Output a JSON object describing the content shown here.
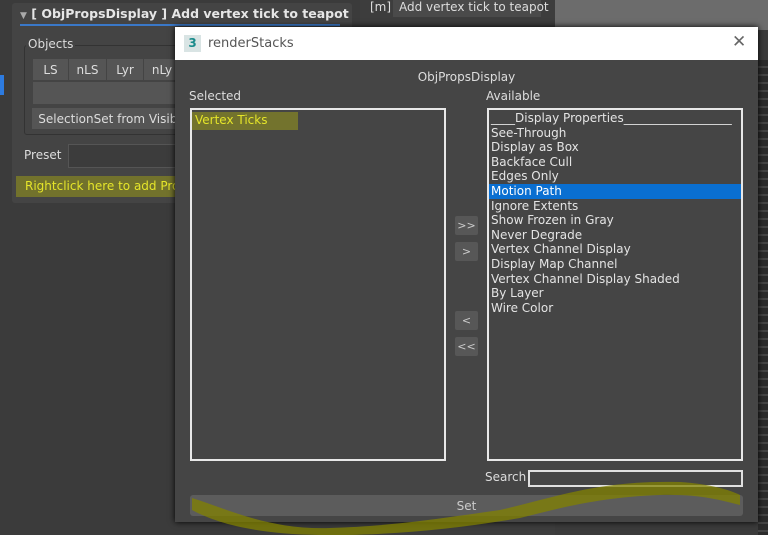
{
  "rollout": {
    "title": "[ ObjPropsDisplay ] Add vertex tick to teapot",
    "objects_label": "Objects",
    "buttons": [
      "LS",
      "nLS",
      "Lyr",
      "nLy"
    ],
    "selection_set": "SelectionSet from Visibl",
    "preset_label": "Preset",
    "hint": "Rightclick here to add Prope"
  },
  "side": {
    "m_label": "[m]",
    "macro": "Add vertex tick to teapot"
  },
  "dialog": {
    "title": "renderStacks",
    "icon_text": "3",
    "heading": "ObjPropsDisplay",
    "selected_label": "Selected",
    "available_label": "Available",
    "selected_items": [
      "Vertex Ticks"
    ],
    "available_items": [
      "____Display Properties__________________",
      "See-Through",
      "Display as Box",
      "Backface Cull",
      "Edges Only",
      "Motion Path",
      "Ignore Extents",
      "Show Frozen in Gray",
      "Never Degrade",
      "Vertex Channel Display",
      "Display Map Channel",
      "Vertex Channel Display Shaded",
      "By Layer",
      "Wire Color"
    ],
    "selected_available": "Motion Path",
    "add_all": ">>",
    "add": ">",
    "remove": "<",
    "remove_all": "<<",
    "search_label": "Search",
    "search_value": "",
    "set_label": "Set",
    "close": "✕"
  },
  "colors": {
    "highlight": "#c8c800",
    "selection": "#0a6fd1"
  }
}
